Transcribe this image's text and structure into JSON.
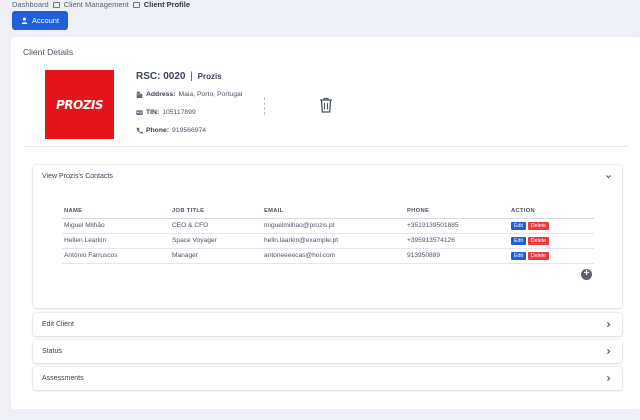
{
  "breadcrumb": [
    "Dashboard",
    "Client Management",
    "Client Profile"
  ],
  "account_button": {
    "label": "Account"
  },
  "card": {
    "title": "Client Details"
  },
  "client": {
    "logo_text": "PROZIS",
    "code": "RSC: 0020",
    "separator": "|",
    "name": "Prozis",
    "address_label": "Address:",
    "address_value": "Maia, Porto, Portugal",
    "tin_label": "TIN:",
    "tin_value": "105117899",
    "phone_label": "Phone:",
    "phone_value": "919566974"
  },
  "contacts": {
    "title": "View Prozis's Contacts",
    "columns": [
      "NAME",
      "JOB TITLE",
      "EMAIL",
      "PHONE",
      "ACTION"
    ],
    "rows": [
      [
        "Miguel Milhão",
        "CEO & CFO",
        "miguelmilhao@prozis.pt",
        "+3519139501885"
      ],
      [
        "Hellen Learkin",
        "Space Voyager",
        "helln.laarkin@example.pt",
        "+395913574126"
      ],
      [
        "António Farruscos",
        "Manager",
        "antoneeeecas@hol.com",
        "913950889"
      ]
    ],
    "edit_label": "Edit",
    "delete_label": "Delete",
    "add_symbol": "+"
  },
  "sections": [
    "Edit Client",
    "Status",
    "Assessments"
  ]
}
